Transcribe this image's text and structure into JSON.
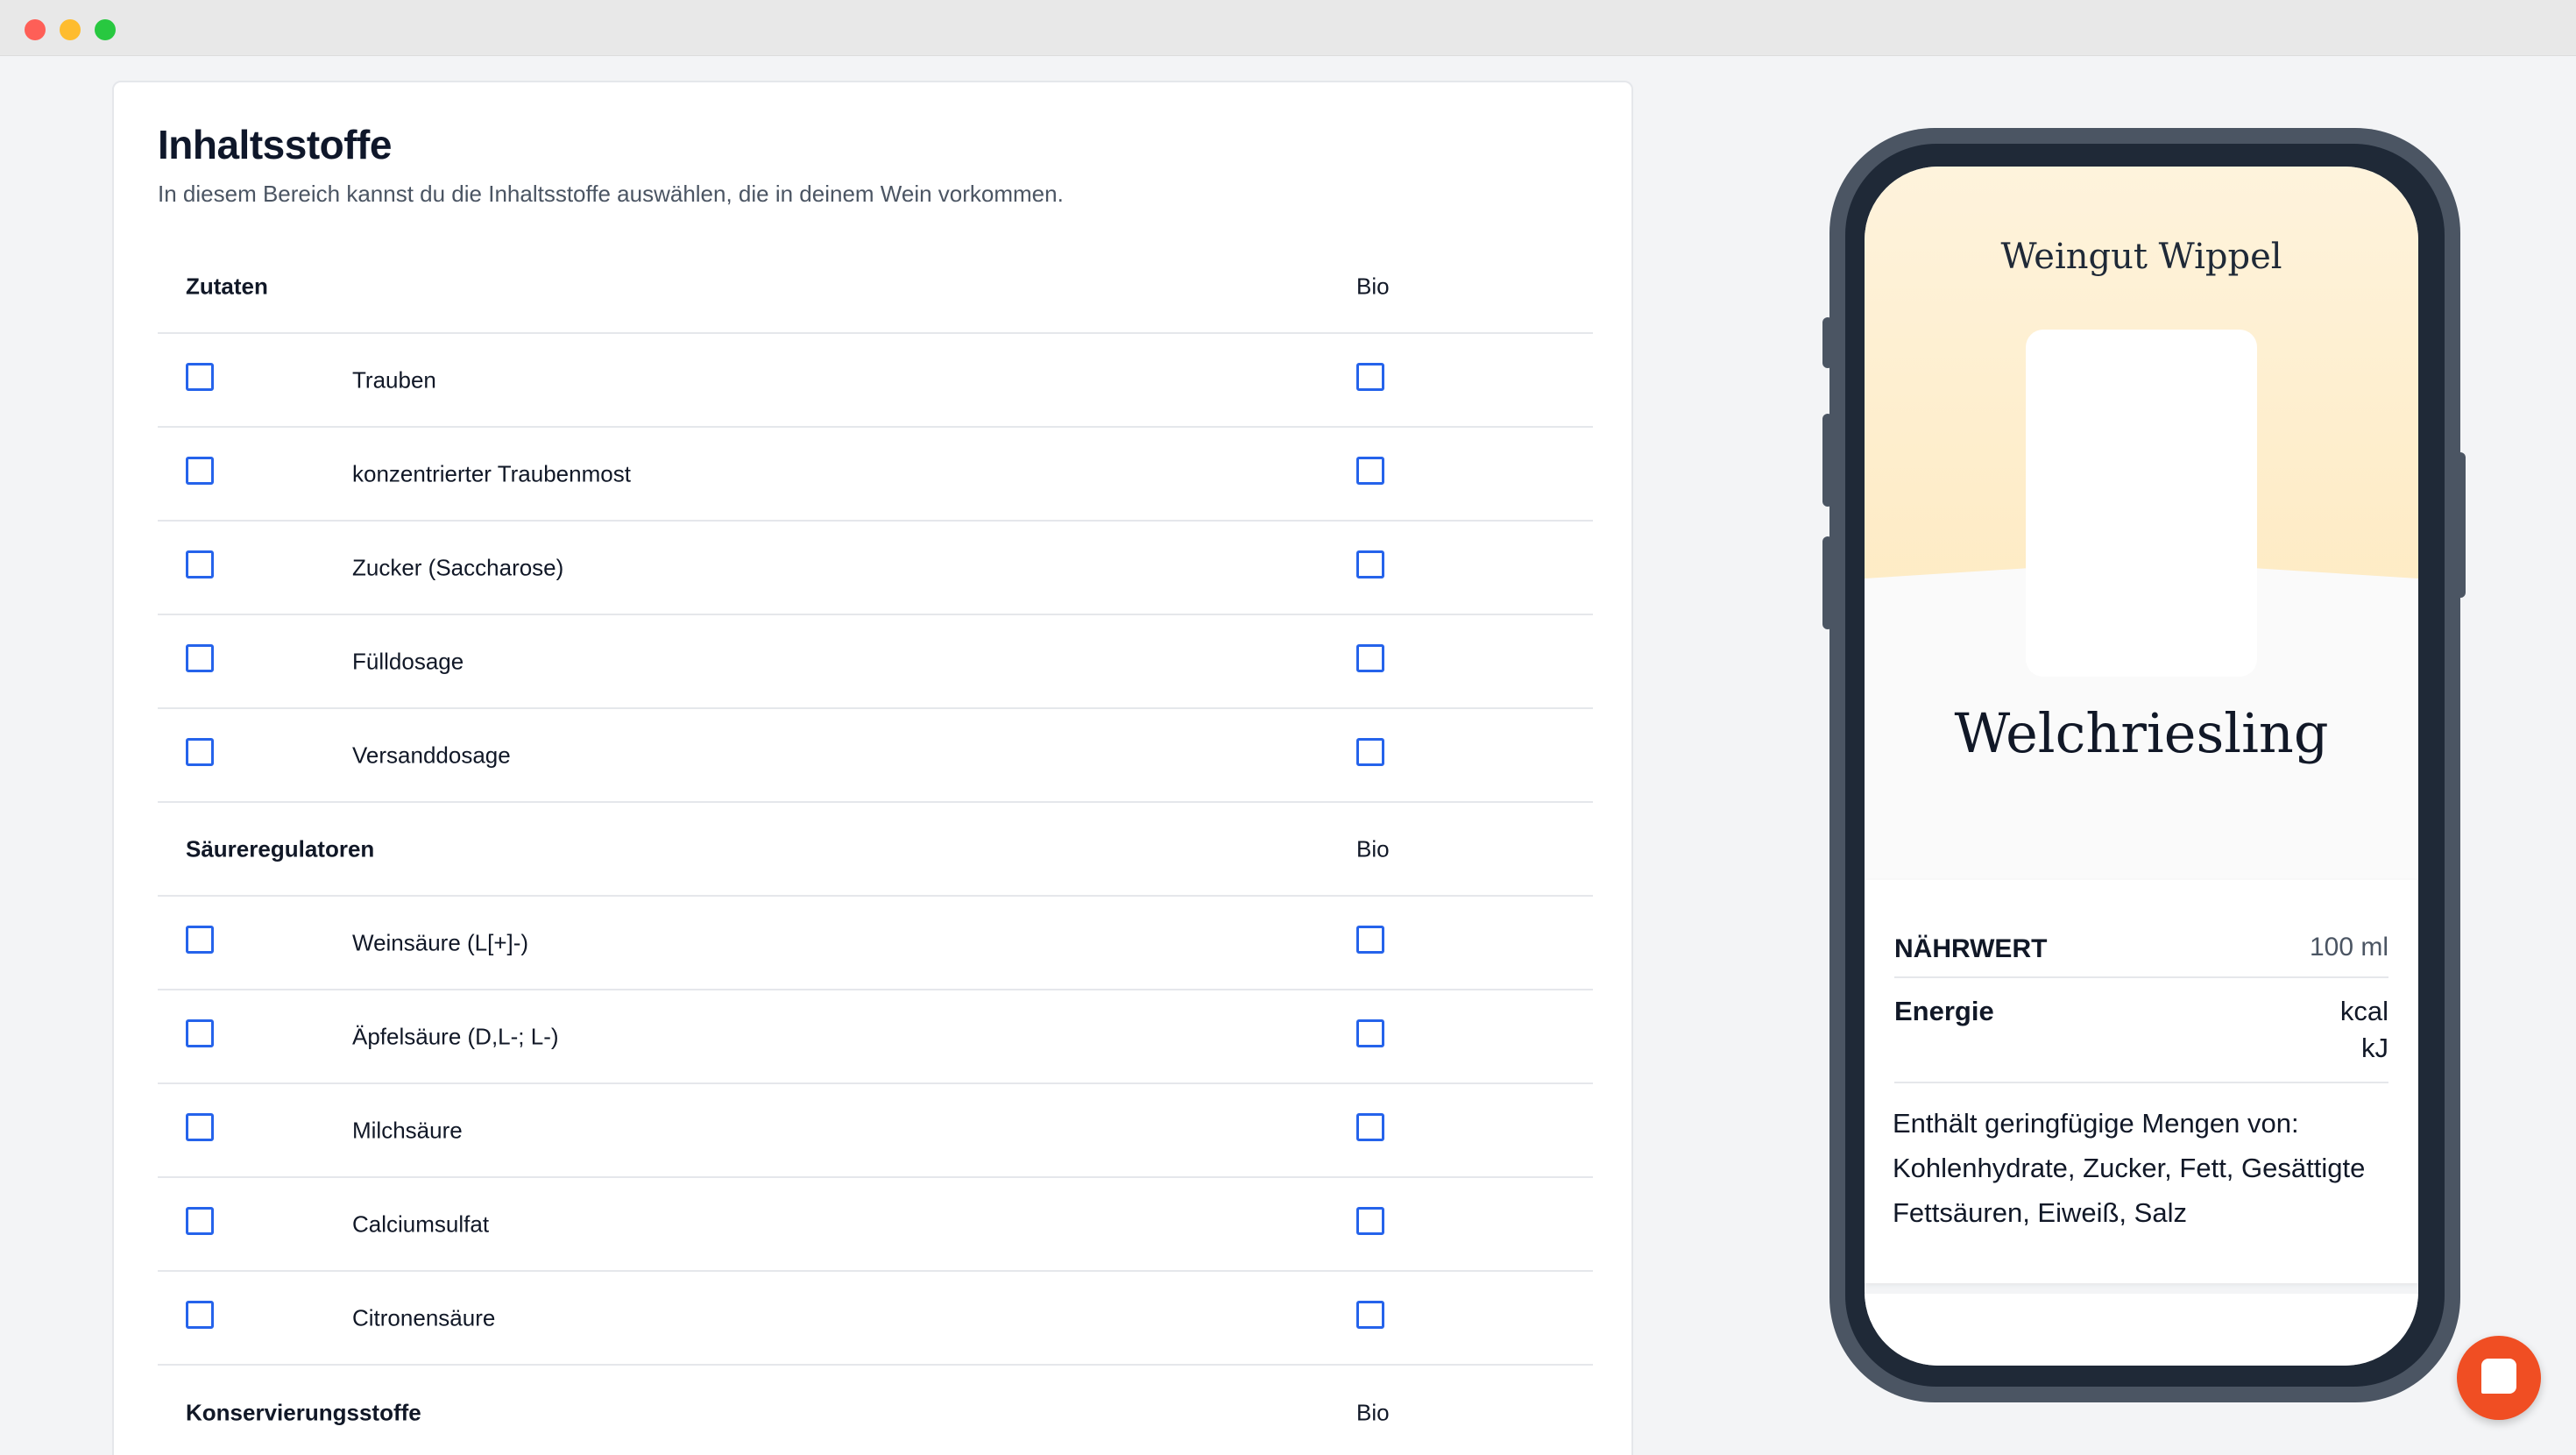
{
  "page": {
    "title": "Inhaltsstoffe",
    "description": "In diesem Bereich kannst du die Inhaltsstoffe auswählen, die in deinem Wein vorkommen."
  },
  "bio_label": "Bio",
  "groups": [
    {
      "name": "Zutaten",
      "items": [
        "Trauben",
        "konzentrierter Traubenmost",
        "Zucker (Saccharose)",
        "Fülldosage",
        "Versanddosage"
      ]
    },
    {
      "name": "Säureregulatoren",
      "items": [
        "Weinsäure (L[+]-)",
        "Äpfelsäure (D,L-; L-)",
        "Milchsäure",
        "Calciumsulfat",
        "Citronensäure"
      ]
    },
    {
      "name": "Konservierungsstoffe",
      "items": []
    }
  ],
  "preview": {
    "winery": "Weingut Wippel",
    "wine_name": "Welchriesling",
    "nutrition_title": "NÄHRWERT",
    "nutrition_unit": "100 ml",
    "energy_label": "Energie",
    "energy_kcal": "kcal",
    "energy_kj": "kJ",
    "note": "Enthält geringfügige Mengen von: Kohlenhydrate, Zucker, Fett, Gesättigte Fettsäuren, Eiweiß, Salz"
  },
  "colors": {
    "checkbox_border": "#2563eb",
    "phone_frame": "#4b5563",
    "chat_button": "#f04e23"
  }
}
